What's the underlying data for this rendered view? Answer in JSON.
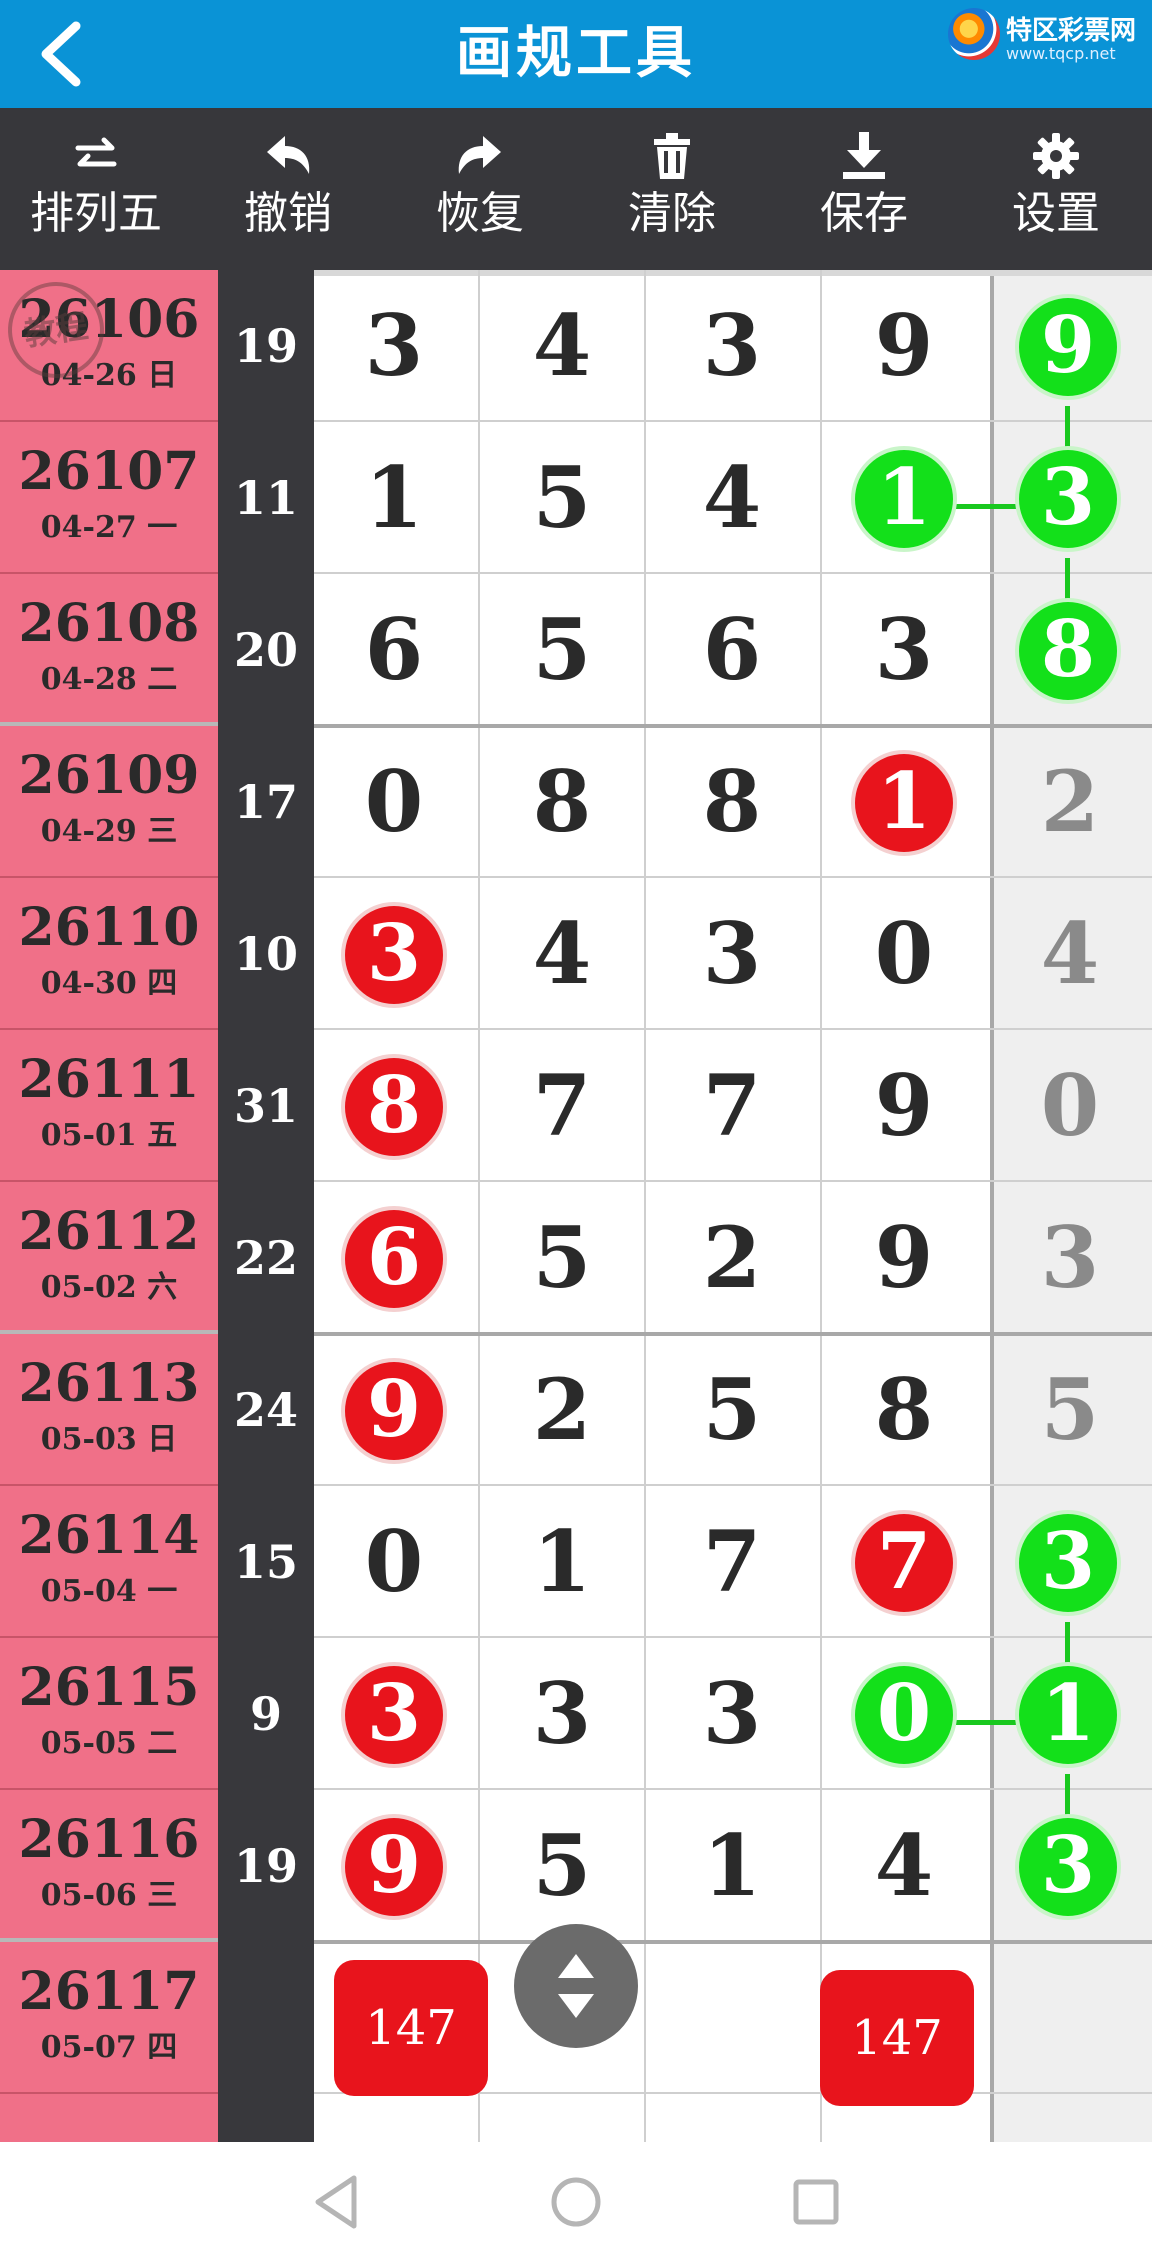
{
  "header": {
    "title": "画规工具",
    "logo_text": "特区彩票网",
    "logo_url": "www.tqcp.net"
  },
  "toolbar": [
    {
      "label": "排列五",
      "icon": "swap-icon"
    },
    {
      "label": "撤销",
      "icon": "undo-icon"
    },
    {
      "label": "恢复",
      "icon": "redo-icon"
    },
    {
      "label": "清除",
      "icon": "trash-icon"
    },
    {
      "label": "保存",
      "icon": "download-icon"
    },
    {
      "label": "设置",
      "icon": "gear-icon"
    }
  ],
  "stamp_text": "教程",
  "rows": [
    {
      "issue": "26106",
      "date": "04-26 日",
      "sum": "19",
      "digits": [
        "3",
        "4",
        "3",
        "9",
        "9"
      ]
    },
    {
      "issue": "26107",
      "date": "04-27 一",
      "sum": "11",
      "digits": [
        "1",
        "5",
        "4",
        "1",
        "3"
      ]
    },
    {
      "issue": "26108",
      "date": "04-28 二",
      "sum": "20",
      "digits": [
        "6",
        "5",
        "6",
        "3",
        "8"
      ]
    },
    {
      "issue": "26109",
      "date": "04-29 三",
      "sum": "17",
      "digits": [
        "0",
        "8",
        "8",
        "1",
        "2"
      ]
    },
    {
      "issue": "26110",
      "date": "04-30 四",
      "sum": "10",
      "digits": [
        "3",
        "4",
        "3",
        "0",
        "4"
      ]
    },
    {
      "issue": "26111",
      "date": "05-01 五",
      "sum": "31",
      "digits": [
        "8",
        "7",
        "7",
        "9",
        "0"
      ]
    },
    {
      "issue": "26112",
      "date": "05-02 六",
      "sum": "22",
      "digits": [
        "6",
        "5",
        "2",
        "9",
        "3"
      ]
    },
    {
      "issue": "26113",
      "date": "05-03 日",
      "sum": "24",
      "digits": [
        "9",
        "2",
        "5",
        "8",
        "5"
      ]
    },
    {
      "issue": "26114",
      "date": "05-04 一",
      "sum": "15",
      "digits": [
        "0",
        "1",
        "7",
        "7",
        "3"
      ]
    },
    {
      "issue": "26115",
      "date": "05-05 二",
      "sum": "9",
      "digits": [
        "3",
        "3",
        "3",
        "0",
        "1"
      ]
    },
    {
      "issue": "26116",
      "date": "05-06 三",
      "sum": "19",
      "digits": [
        "9",
        "5",
        "1",
        "4",
        "3"
      ]
    }
  ],
  "next_issue": {
    "issue": "26117",
    "date": "05-07 四"
  },
  "predictions": [
    {
      "column": 1,
      "label": "147"
    },
    {
      "column": 4,
      "label": "147"
    }
  ],
  "colors": {
    "topbar": "#0a93d6",
    "toolbar": "#37373b",
    "issue_col": "#f07088",
    "red_ball": "#e8141c",
    "green_ball": "#13e01a"
  }
}
